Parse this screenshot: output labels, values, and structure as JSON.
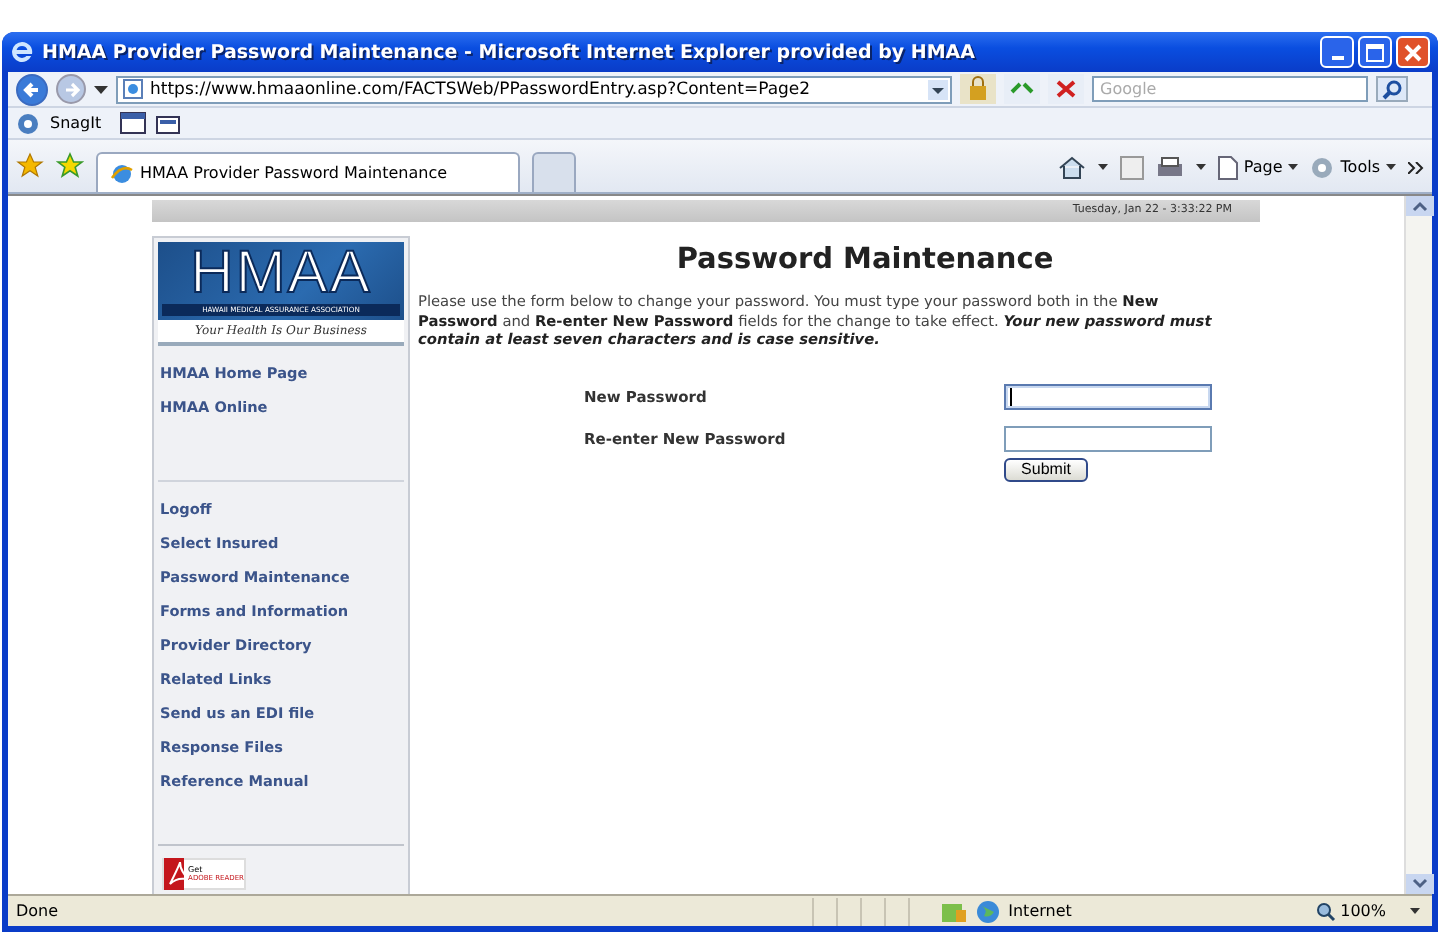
{
  "window": {
    "title": "HMAA Provider Password Maintenance - Microsoft Internet Explorer provided by HMAA"
  },
  "address_bar": {
    "url": "https://www.hmaaonline.com/FACTSWeb/PPasswordEntry.asp?Content=Page2",
    "search_placeholder": "Google"
  },
  "links_bar": {
    "items": [
      "SnagIt"
    ]
  },
  "tabs": [
    {
      "label": "HMAA Provider Password Maintenance",
      "selected": true
    },
    {
      "selected": false
    }
  ],
  "command_bar": [
    "Page",
    "Tools"
  ],
  "page": {
    "date": "Tuesday, Jan 22 - 3:33:22 PM",
    "logo": {
      "name": "HMAA",
      "subtitle": "HAWAII MEDICAL ASSURANCE ASSOCIATION",
      "tagline": "Your Health Is Our Business"
    },
    "sidebar_groups": [
      [
        "HMAA Home Page",
        "HMAA Online"
      ],
      [
        "Logoff",
        "Select Insured",
        "Password Maintenance",
        "Forms and Information",
        "Provider Directory",
        "Related Links",
        "Send us an EDI file",
        "Response Files",
        "Reference Manual"
      ]
    ],
    "badge": {
      "line_1": "Get",
      "line_2": "ADOBE READER"
    },
    "heading": "Password Maintenance",
    "intro": "Please use the form below to change your password. You must type your password both in the **New Password** and **Re-enter New Password** fields for the change to take effect.",
    "intro_emphasis": "Your new password must contain at least seven characters and is case sensitive.",
    "fields": [
      {
        "label": "New Password",
        "focused": true
      },
      {
        "label": "Re-enter New Password",
        "focused": false
      }
    ],
    "submit": "Submit"
  },
  "status_bar": {
    "text": "Done",
    "zone": "Internet",
    "zoom": "100%"
  }
}
